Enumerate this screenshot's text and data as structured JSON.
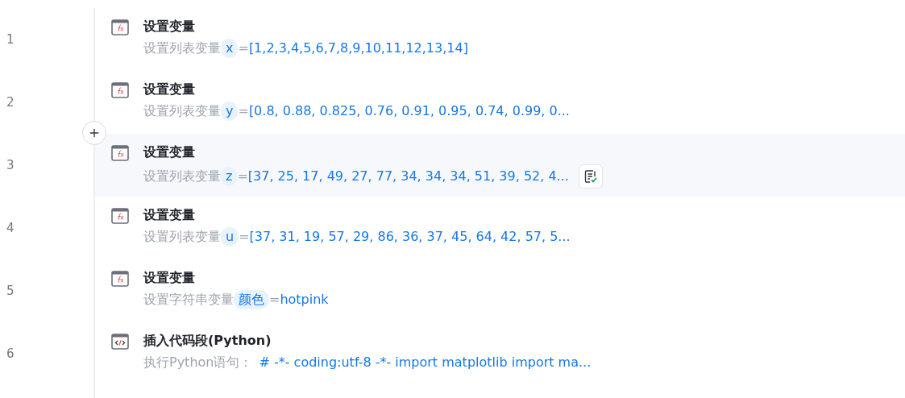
{
  "steps": [
    {
      "number": "1",
      "kind": "variable",
      "title": "设置变量",
      "prefix": "设置列表变量",
      "variable": "x",
      "equals": "=",
      "value": "[1,2,3,4,5,6,7,8,9,10,11,12,13,14]",
      "selected": false
    },
    {
      "number": "2",
      "kind": "variable",
      "title": "设置变量",
      "prefix": "设置列表变量",
      "variable": "y",
      "equals": "=",
      "value": "[0.8, 0.88, 0.825, 0.76, 0.91, 0.95, 0.74, 0.99, 0...",
      "selected": false
    },
    {
      "number": "3",
      "kind": "variable",
      "title": "设置变量",
      "prefix": "设置列表变量",
      "variable": "z",
      "equals": "=",
      "value": "[37, 25, 17, 49, 27, 77, 34, 34, 34, 51, 39, 52, 4...",
      "selected": true
    },
    {
      "number": "4",
      "kind": "variable",
      "title": "设置变量",
      "prefix": "设置列表变量",
      "variable": "u",
      "equals": "=",
      "value": "[37, 31, 19, 57, 29, 86, 36, 37, 45, 64, 42, 57, 5...",
      "selected": false
    },
    {
      "number": "5",
      "kind": "variable",
      "title": "设置变量",
      "prefix": "设置字符串变量",
      "variable": "颜色",
      "equals": "=",
      "value": "hotpink",
      "selected": false
    },
    {
      "number": "6",
      "kind": "code",
      "title": "插入代码段(Python)",
      "prefix": "执行Python语句：",
      "value": "# -*- coding:utf-8 -*- import matplotlib import ma...",
      "selected": false
    }
  ]
}
